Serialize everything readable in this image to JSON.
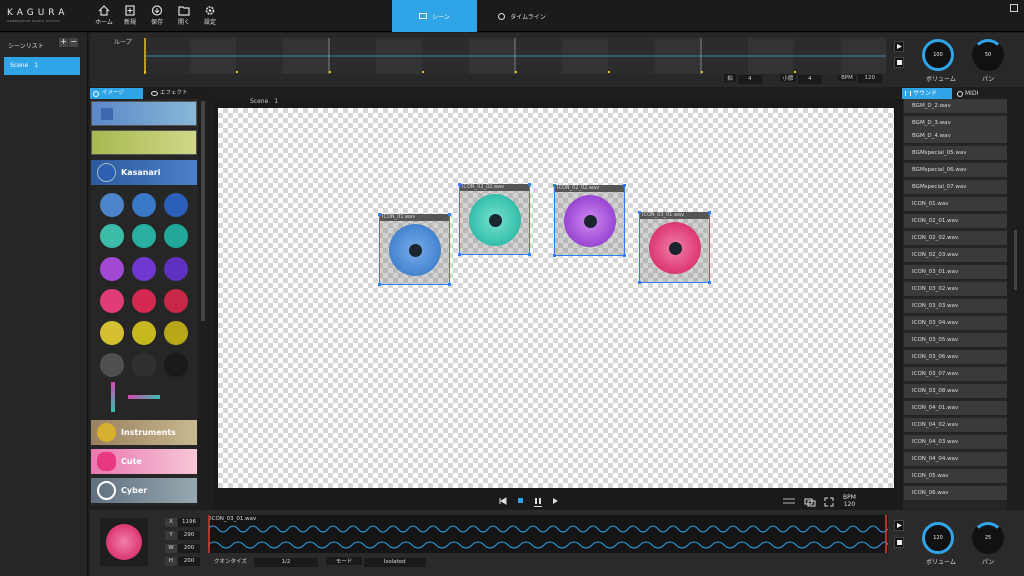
{
  "app": {
    "logo": "KAGURA",
    "logo_sub": "GENERATIVE MUSIC STUDIO"
  },
  "toolbar": [
    {
      "label": "ホーム",
      "icon": "home-icon"
    },
    {
      "label": "新規",
      "icon": "new-file-icon"
    },
    {
      "label": "保存",
      "icon": "save-icon"
    },
    {
      "label": "開く",
      "icon": "folder-open-icon"
    },
    {
      "label": "設定",
      "icon": "gear-icon"
    }
  ],
  "tabs": {
    "scene": "シーン",
    "timeline": "タイムライン"
  },
  "scene_list": {
    "title": "シーンリスト",
    "add": "+",
    "remove": "−",
    "items": [
      "Scene　1"
    ]
  },
  "loop": {
    "label": "ループ",
    "beat_label": "拍",
    "beat_value": "4",
    "bar_label": "小節",
    "bar_value": "4",
    "bpm_label": "BPM",
    "bpm_value": "120",
    "volume_label": "ボリューム",
    "volume_value": "100",
    "pan_label": "パン",
    "pan_value": "50"
  },
  "left_tabs": {
    "image": "イメージ",
    "effect": "エフェクト"
  },
  "palette": {
    "categories": [
      "Kasanari",
      "Instruments",
      "Cute",
      "Cyber"
    ],
    "accent": "#2fa4e7"
  },
  "canvas": {
    "title": "Scene　1",
    "icons": [
      {
        "label": "ICON_01.wav",
        "color": "#4a8ad4"
      },
      {
        "label": "ICON_02_02.wav",
        "color": "#3cc4b0"
      },
      {
        "label": "ICON_02_02.wav",
        "color": "#a24fd8"
      },
      {
        "label": "ICON_03_01.wav",
        "color": "#e0407a"
      }
    ],
    "bpm_label": "BPM",
    "bpm_value": "120"
  },
  "sound_tabs": {
    "sound": "サウンド",
    "midi": "MIDI"
  },
  "sounds": [
    "BGM_D_2.wav",
    "BGM_D_3.wav",
    "BGM_D_4.wav",
    "BGMspecial_05.wav",
    "BGMspecial_06.wav",
    "BGMspecial_07.wav",
    "ICON_01.wav",
    "ICON_02_01.wav",
    "ICON_02_02.wav",
    "ICON_02_03.wav",
    "ICON_03_01.wav",
    "ICON_03_02.wav",
    "ICON_03_03.wav",
    "ICON_03_04.wav",
    "ICON_03_05.wav",
    "ICON_03_06.wav",
    "ICON_03_07.wav",
    "ICON_03_08.wav",
    "ICON_04_01.wav",
    "ICON_04_02.wav",
    "ICON_04_03.wav",
    "ICON_04_04.wav",
    "ICON_05.wav",
    "ICON_06.wav"
  ],
  "selected": {
    "x_label": "X",
    "x": "1196",
    "y_label": "Y",
    "y": "290",
    "w_label": "W",
    "w": "200",
    "h_label": "H",
    "h": "200",
    "file": "ICON_03_01.wav",
    "quantize_label": "クオンタイズ",
    "quantize": "1/2",
    "mode_label": "モード",
    "mode": "Isolated",
    "volume_label": "ボリューム",
    "volume": "120",
    "pan_label": "パン",
    "pan": "25"
  }
}
